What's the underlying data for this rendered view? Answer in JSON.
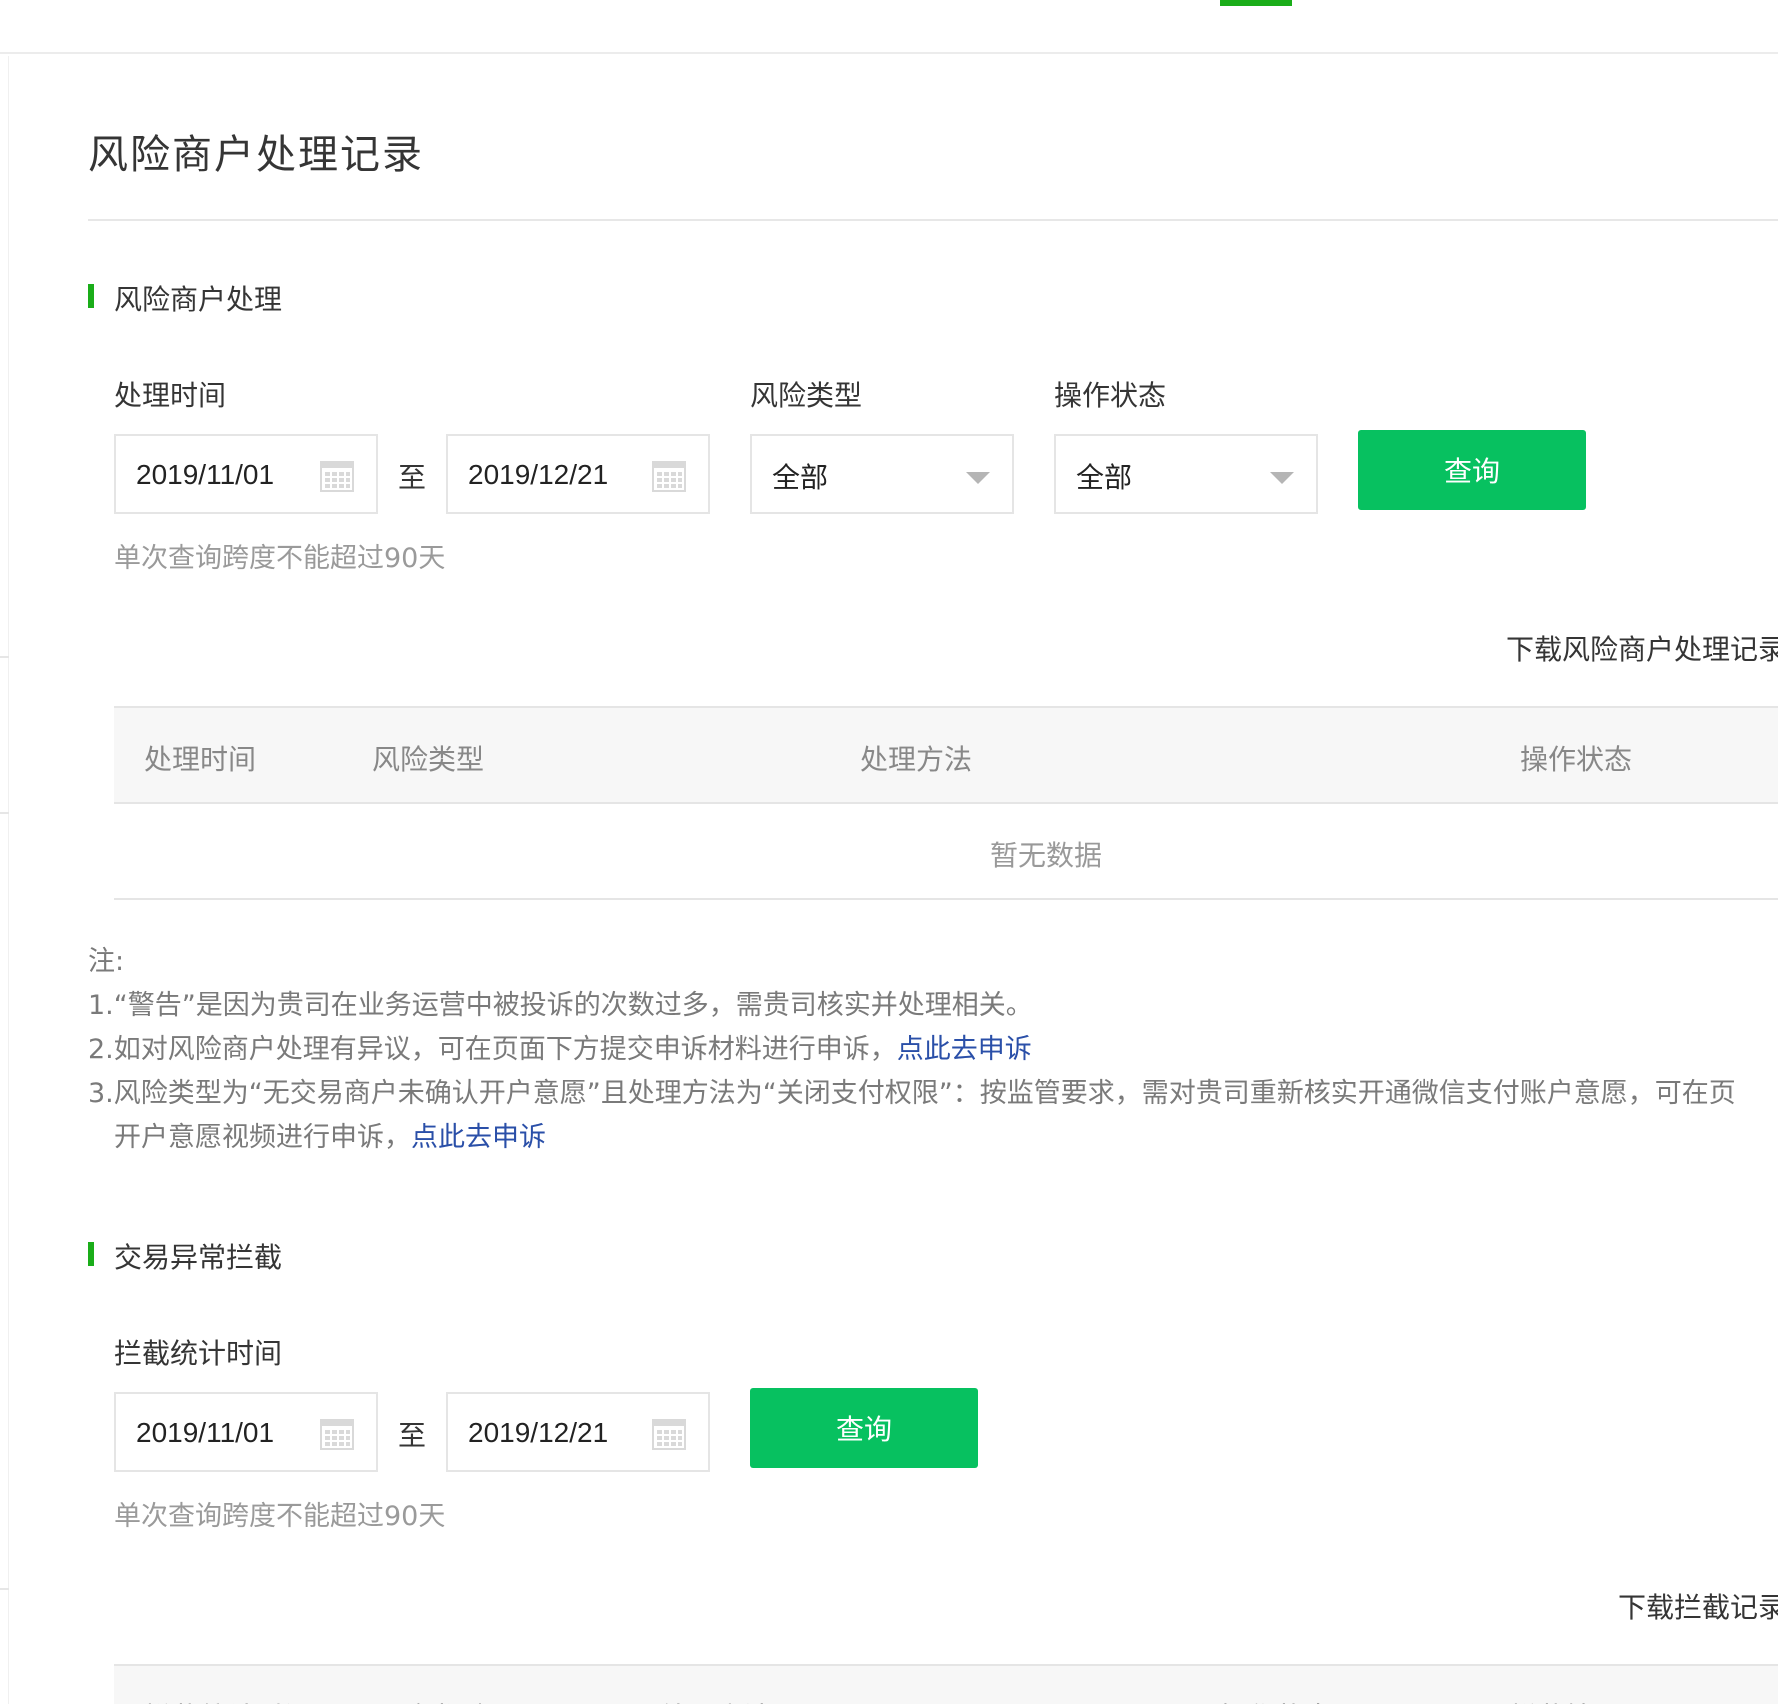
{
  "page": {
    "title": "风险商户处理记录"
  },
  "risk_section": {
    "title": "风险商户处理",
    "filters": {
      "time_label": "处理时间",
      "start_date": "2019/11/01",
      "to_label": "至",
      "end_date": "2019/12/21",
      "risk_type_label": "风险类型",
      "risk_type_value": "全部",
      "status_label": "操作状态",
      "status_value": "全部",
      "query_button": "查询",
      "hint": "单次查询跨度不能超过90天"
    },
    "download_label": "下载风险商户处理记录",
    "table": {
      "columns": [
        "处理时间",
        "风险类型",
        "处理方法",
        "操作状态"
      ],
      "empty_text": "暂无数据"
    },
    "notes": {
      "heading": "注:",
      "line1": "1.“警告”是因为贵司在业务运营中被投诉的次数过多，需贵司核实并处理相关。",
      "line2_text": "2.如对风险商户处理有异议，可在页面下方提交申诉材料进行申诉，",
      "line2_link": "点此去申诉",
      "line3_text": "3.风险类型为“无交易商户未确认开户意愿”且处理方法为“关闭支付权限”：按监管要求，需对贵司重新核实开通微信支付账户意愿，可在页",
      "line4_text": "开户意愿视频进行申诉，",
      "line4_link": "点此去申诉"
    }
  },
  "intercept_section": {
    "title": "交易异常拦截",
    "filters": {
      "time_label": "拦截统计时间",
      "start_date": "2019/11/01",
      "to_label": "至",
      "end_date": "2019/12/21",
      "query_button": "查询",
      "hint": "单次查询跨度不能超过90天"
    },
    "download_label": "下载拦截记录",
    "table": {
      "columns": [
        "拦截统计时间",
        "风险类型",
        "处理方法",
        "操作状态",
        "拦截情况"
      ]
    }
  },
  "colors": {
    "accent": "#07c160",
    "section_bar": "#1aad19",
    "link": "#2a4fa8"
  }
}
